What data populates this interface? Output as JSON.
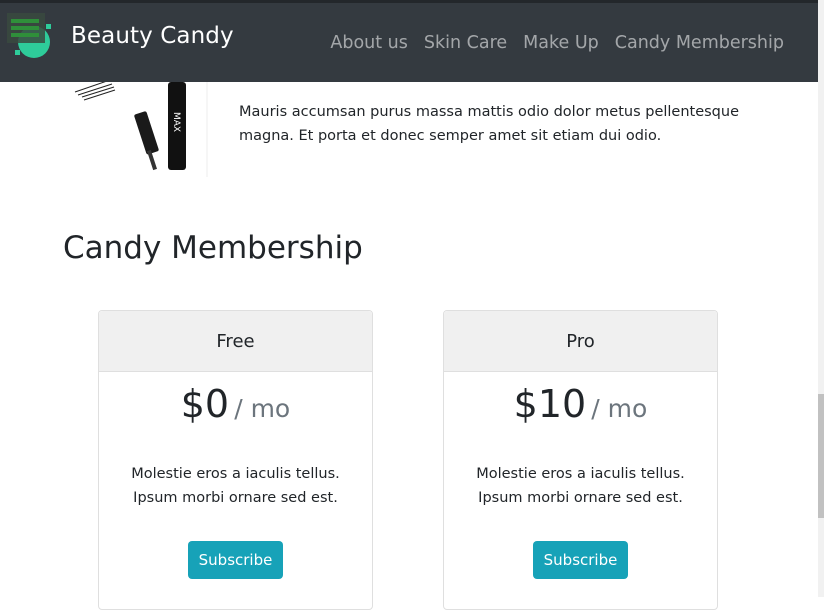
{
  "navbar": {
    "brand": "Beauty Candy",
    "links": [
      "About us",
      "Skin Care",
      "Make Up",
      "Candy Membership"
    ]
  },
  "product": {
    "description": "Mauris accumsan purus massa mattis odio dolor metus pellentesque magna. Et porta et donec semper amet sit etiam dui odio."
  },
  "membership": {
    "title": "Candy Membership",
    "plans": [
      {
        "name": "Free",
        "price": "$0",
        "period": "/ mo",
        "desc_line1": "Molestie eros a iaculis tellus.",
        "desc_line2": "Ipsum morbi ornare sed est.",
        "button": "Subscribe"
      },
      {
        "name": "Pro",
        "price": "$10",
        "period": "/ mo",
        "desc_line1": "Molestie eros a iaculis tellus.",
        "desc_line2": "Ipsum morbi ornare sed est.",
        "button": "Subscribe"
      }
    ]
  },
  "colors": {
    "navbar_bg": "#343a40",
    "accent": "#17a2b8",
    "logo": "#2ecc9a"
  }
}
